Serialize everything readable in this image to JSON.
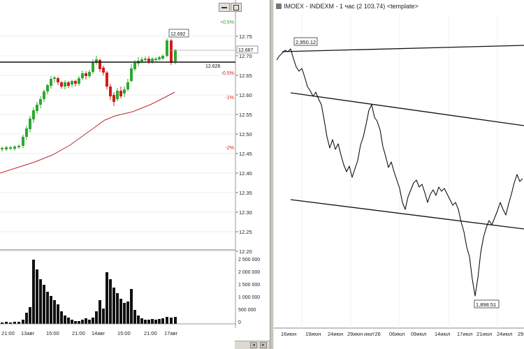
{
  "left_chart": {
    "y_ticks": [
      "12.75",
      "12.70",
      "12.65",
      "12.60",
      "12.55",
      "12.50",
      "12.45",
      "12.40",
      "12.35",
      "12.30",
      "12.25",
      "12.20"
    ],
    "pct_labels": [
      "+0.5%",
      "-0.5%",
      "-1%",
      "-2%"
    ],
    "last_price": "12.667",
    "high_callout": "12.692",
    "level_label": "12.626",
    "x_ticks": [
      "21:00",
      "13авг",
      "15:00",
      "21:00",
      "14авг",
      "15:00",
      "21:00",
      "17авг"
    ],
    "volume_ticks": [
      "2 500 000",
      "2 000 000",
      "1 500 000",
      "1 000 000",
      "500 000",
      "0"
    ],
    "colors": {
      "up": "#2ea82e",
      "down": "#d21c1c",
      "ma": "#c0262b",
      "level": "#111111"
    }
  },
  "right_chart": {
    "title": "IMOEX - INDEXM - 1 час (2 103.74) <template>",
    "high_callout": "2,950.12",
    "low_callout": "1,898.51",
    "x_ticks": [
      "16июн",
      "19июн",
      "24июн",
      "29июн",
      "июл'26",
      "06июл",
      "09июл",
      "14июл",
      "17июл",
      "21июл",
      "24июл",
      "29"
    ]
  }
}
